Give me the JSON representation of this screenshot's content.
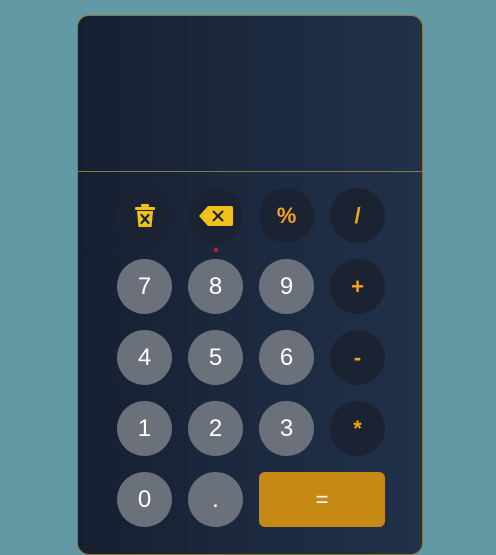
{
  "display": {
    "expression": "",
    "result": ""
  },
  "keys": {
    "clear": {
      "icon": "trash-icon"
    },
    "backspace": {
      "icon": "backspace-icon"
    },
    "percent": "%",
    "divide": "/",
    "seven": "7",
    "eight": "8",
    "nine": "9",
    "plus": "+",
    "four": "4",
    "five": "5",
    "six": "6",
    "minus": "-",
    "one": "1",
    "two": "2",
    "three": "3",
    "multiply": "*",
    "zero": "0",
    "decimal": ".",
    "equals": "="
  },
  "colors": {
    "background": "#6399a5",
    "panel_border": "#8a7640",
    "digit_key": "#6b717b",
    "operator_key": "#1b2333",
    "accent": "#f2a51c",
    "equals_key": "#c68913",
    "indicator": "#c8202a"
  }
}
